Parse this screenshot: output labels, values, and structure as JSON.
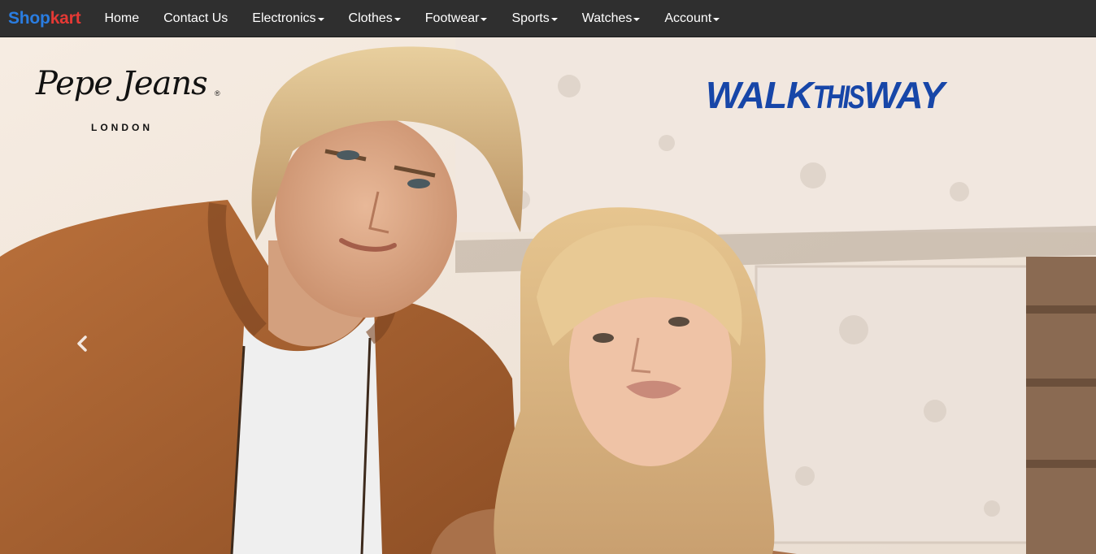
{
  "brand": {
    "part1": "Shop",
    "part2": "kart",
    "color1": "#2a7de1",
    "color2": "#e53935"
  },
  "nav": {
    "home": "Home",
    "contact": "Contact Us",
    "electronics": "Electronics",
    "clothes": "Clothes",
    "footwear": "Footwear",
    "sports": "Sports",
    "watches": "Watches",
    "account": "Account"
  },
  "hero": {
    "logo_left_script": "Pepe Jeans",
    "logo_left_city": "LONDON",
    "logo_right_part1": "WALK",
    "logo_right_part2": "THIS",
    "logo_right_part3": "WAY",
    "prev_icon": "chevron-left-icon"
  },
  "colors": {
    "navbar": "#2f2f2f",
    "walk_logo": "#1746a8"
  }
}
